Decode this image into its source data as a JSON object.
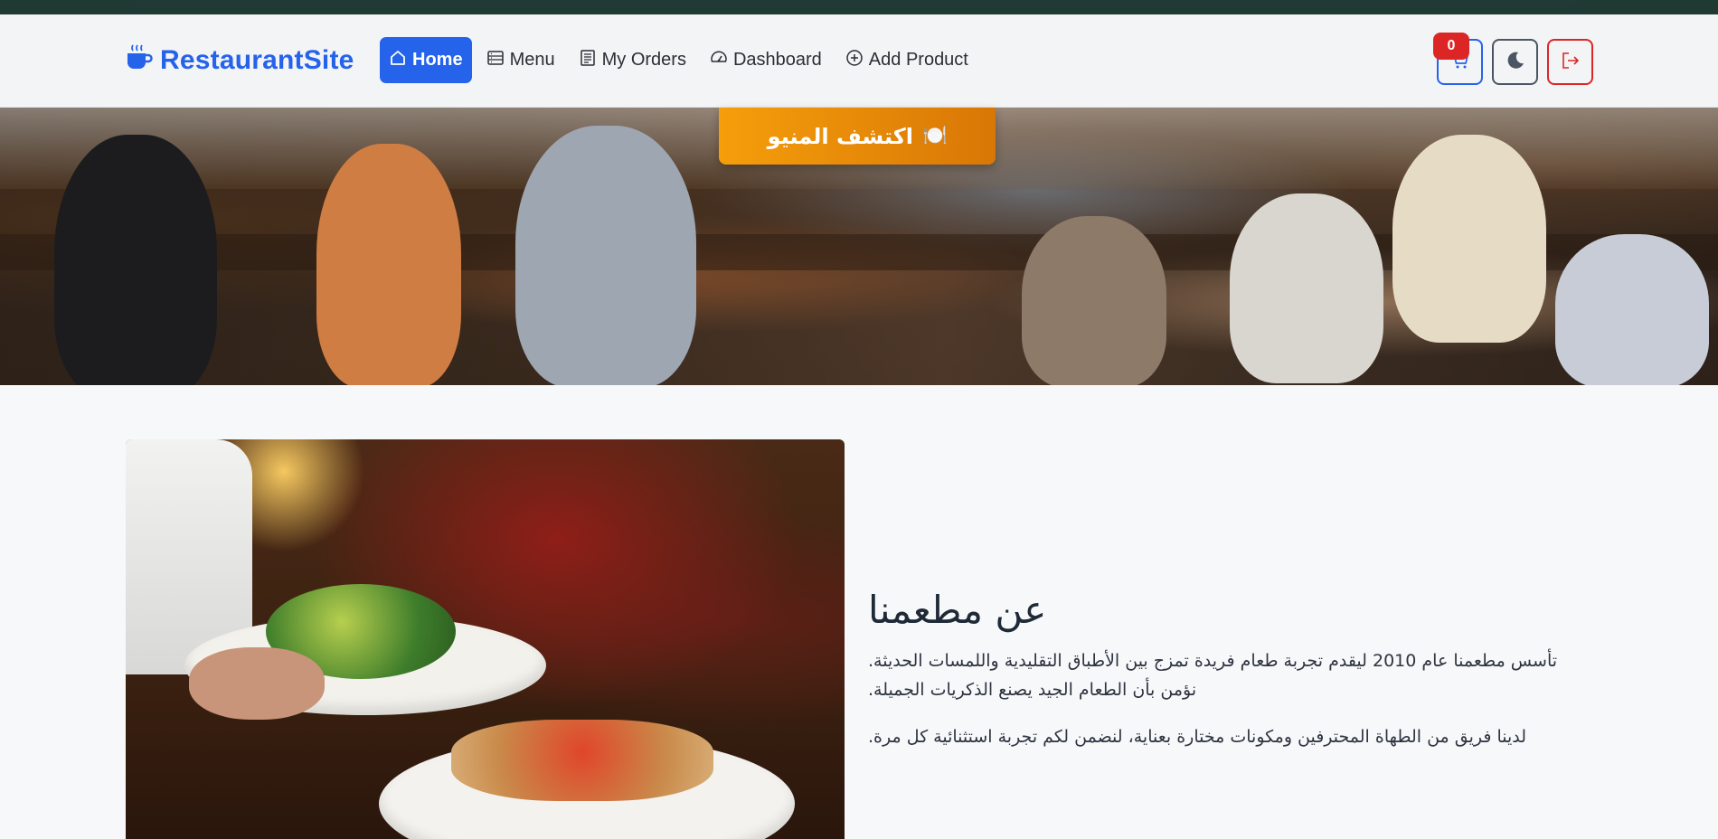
{
  "brand": {
    "name": "RestaurantSite",
    "icon": "coffee-cup-icon",
    "color": "#2563eb"
  },
  "nav": {
    "items": [
      {
        "label": "Home",
        "icon": "home-icon",
        "active": true
      },
      {
        "label": "Menu",
        "icon": "menu-list-icon",
        "active": false
      },
      {
        "label": "My Orders",
        "icon": "receipt-icon",
        "active": false
      },
      {
        "label": "Dashboard",
        "icon": "speedometer-icon",
        "active": false
      },
      {
        "label": "Add Product",
        "icon": "plus-circle-icon",
        "active": false
      }
    ]
  },
  "actions": {
    "cart": {
      "icon": "cart-icon",
      "count": "0"
    },
    "theme": {
      "icon": "moon-icon"
    },
    "logout": {
      "icon": "logout-icon"
    }
  },
  "hero": {
    "cta_label": "اكتشف المنيو",
    "cta_emoji": "🍽️"
  },
  "about": {
    "title": "عن مطعمنا",
    "paragraph1": "تأسس مطعمنا عام 2010 ليقدم تجربة طعام فريدة تمزج بين الأطباق التقليدية واللمسات الحديثة. نؤمن بأن الطعام الجيد يصنع الذكريات الجميلة.",
    "paragraph2": "لدينا فريق من الطهاة المحترفين ومكونات مختارة بعناية، لنضمن لكم تجربة استثنائية كل مرة."
  },
  "colors": {
    "primary": "#2563eb",
    "danger": "#dc2626",
    "accent": "#f59e0b"
  }
}
